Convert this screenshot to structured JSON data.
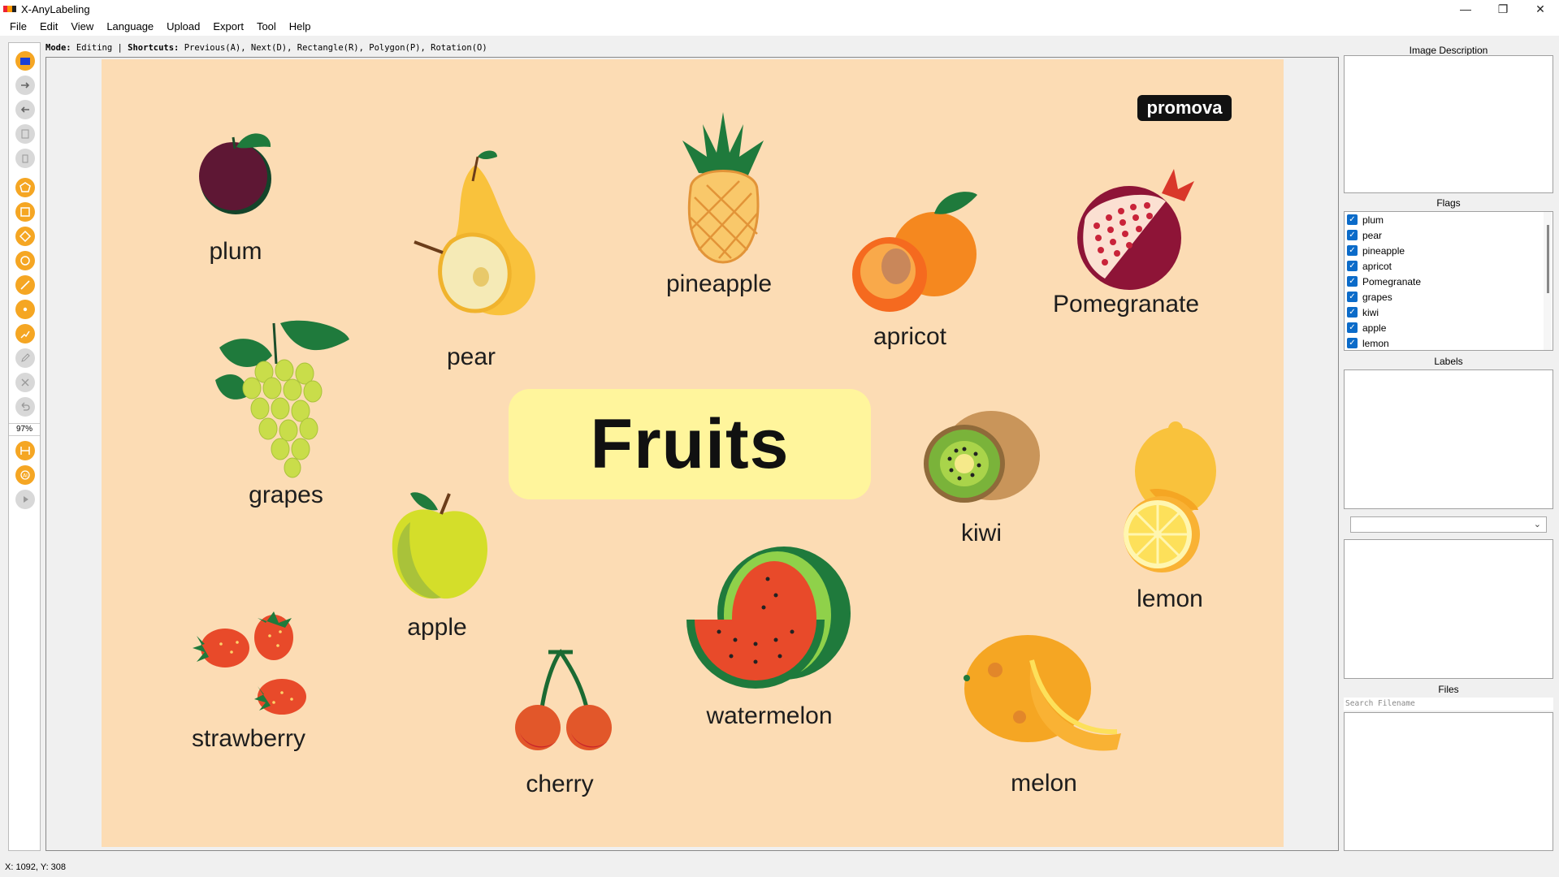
{
  "window": {
    "title": "X-AnyLabeling",
    "minimize": "—",
    "restore": "❐",
    "close": "✕"
  },
  "menu": [
    "File",
    "Edit",
    "View",
    "Language",
    "Upload",
    "Export",
    "Tool",
    "Help"
  ],
  "modebar": {
    "mode_label": "Mode:",
    "mode_value": " Editing | ",
    "shortcuts_label": "Shortcuts:",
    "shortcuts_value": " Previous(A), Next(D), Rectangle(R), Polygon(P), Rotation(O)"
  },
  "toolbar": {
    "zoom": "97%"
  },
  "image": {
    "brand": "promova",
    "title": "Fruits",
    "labels": {
      "plum": "plum",
      "pear": "pear",
      "pineapple": "pineapple",
      "apricot": "apricot",
      "pomegranate": "Pomegranate",
      "grapes": "grapes",
      "kiwi": "kiwi",
      "lemon": "lemon",
      "apple": "apple",
      "watermelon": "watermelon",
      "strawberry": "strawberry",
      "cherry": "cherry",
      "melon": "melon"
    }
  },
  "panels": {
    "image_description": "Image Description",
    "flags_title": "Flags",
    "flags": [
      "plum",
      "pear",
      "pineapple",
      "apricot",
      "Pomegranate",
      "grapes",
      "kiwi",
      "apple",
      "lemon"
    ],
    "labels_title": "Labels",
    "files_title": "Files",
    "search_placeholder": "Search Filename"
  },
  "status": "X: 1092, Y: 308",
  "colors": {
    "accent_orange": "#f5a623",
    "checkbox_blue": "#0b6bc9",
    "canvas_bg": "#fcdcb4",
    "title_bg": "#fff59c"
  },
  "icons": [
    "open-file-icon",
    "next-image-icon",
    "prev-image-icon",
    "save-icon",
    "delete-file-icon",
    "polygon-icon",
    "rectangle-icon",
    "rotation-icon",
    "circle-icon",
    "line-icon",
    "point-icon",
    "linestrip-icon",
    "edit-icon",
    "delete-shape-icon",
    "undo-icon",
    "fit-width-icon",
    "ai-icon",
    "play-icon"
  ]
}
